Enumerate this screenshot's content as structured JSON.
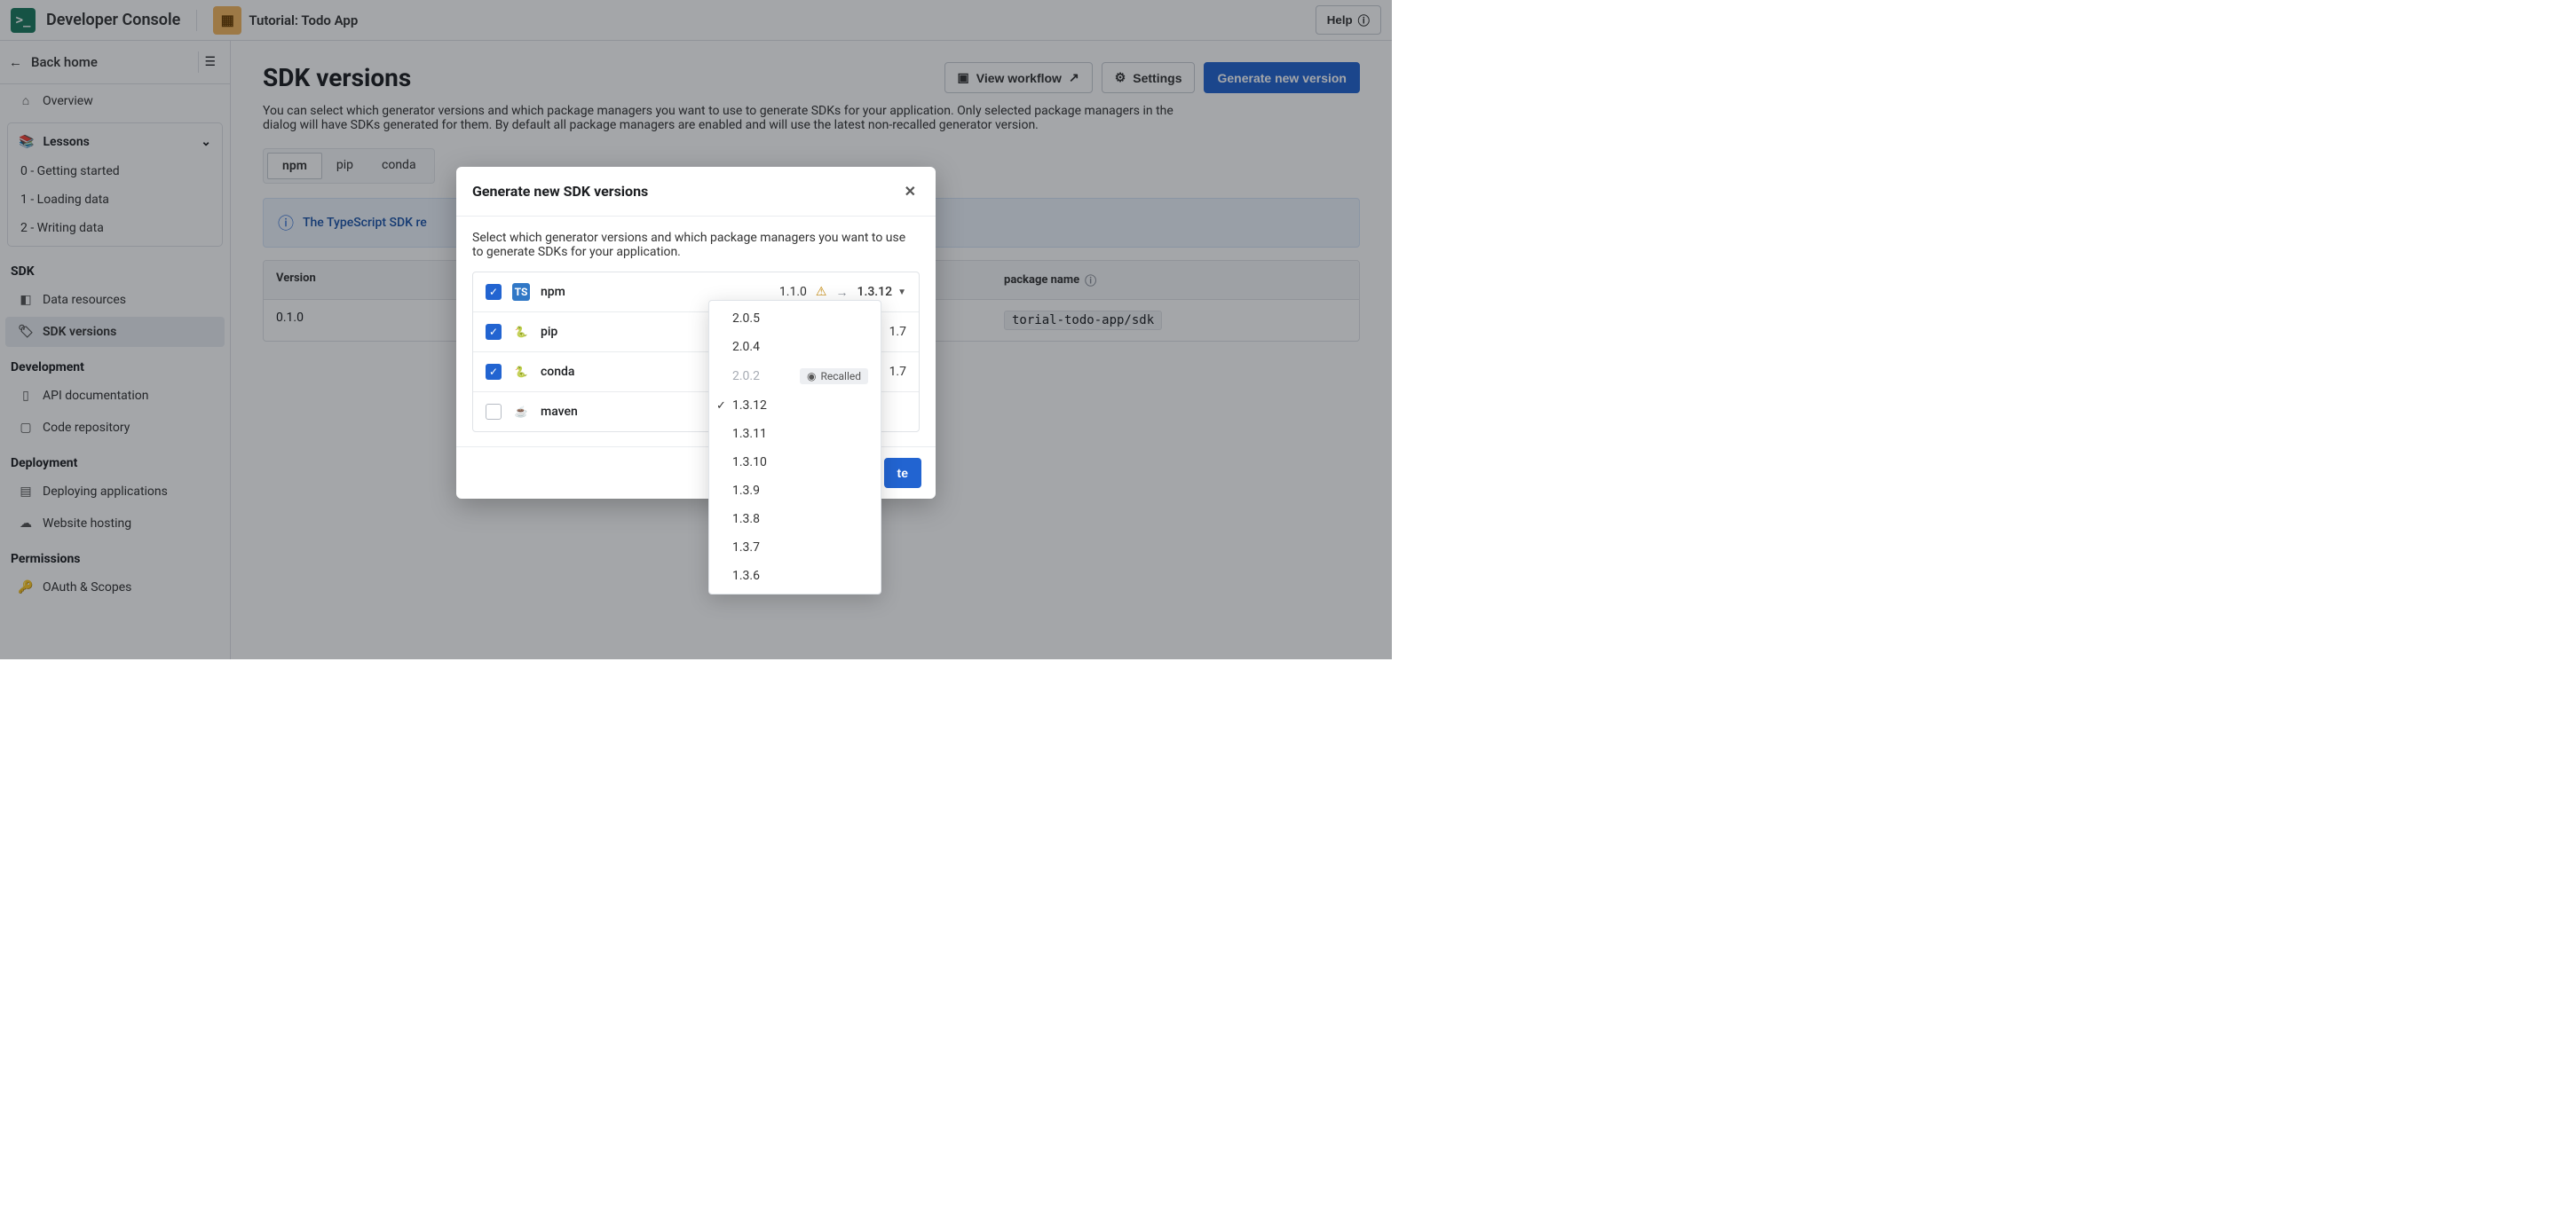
{
  "topbar": {
    "brand": "Developer Console",
    "tutorial_label": "Tutorial: Todo App",
    "help_label": "Help"
  },
  "sidebar": {
    "back_label": "Back home",
    "overview": "Overview",
    "lessons_label": "Lessons",
    "lessons": [
      "0 - Getting started",
      "1 - Loading data",
      "2 - Writing data"
    ],
    "groups": {
      "sdk_title": "SDK",
      "sdk_items": {
        "data_resources": "Data resources",
        "sdk_versions": "SDK versions"
      },
      "dev_title": "Development",
      "dev_items": {
        "api_docs": "API documentation",
        "code_repo": "Code repository"
      },
      "deploy_title": "Deployment",
      "deploy_items": {
        "deploying": "Deploying applications",
        "hosting": "Website hosting"
      },
      "perm_title": "Permissions",
      "perm_items": {
        "oauth": "OAuth & Scopes"
      }
    }
  },
  "main": {
    "title": "SDK versions",
    "view_workflow": "View workflow",
    "settings": "Settings",
    "generate_new_version": "Generate new version",
    "subtext": "You can select which generator versions and which package managers you want to use to generate SDKs for your application. Only selected package managers in the dialog will have SDKs generated for them. By default all package managers are enabled and will use the latest non-recalled generator version.",
    "tabs": [
      "npm",
      "pip",
      "conda"
    ],
    "info_banner": "The TypeScript SDK re",
    "table": {
      "col_version": "Version",
      "col_package": "package name",
      "row": {
        "version": "0.1.0",
        "pkg": "torial-todo-app/sdk"
      }
    }
  },
  "modal": {
    "title": "Generate new SDK versions",
    "desc": "Select which generator versions and which package managers you want to use to generate SDKs for your application.",
    "rows": [
      {
        "name": "npm",
        "checked": true,
        "icon": "ts",
        "from": "1.1.0",
        "warn": true,
        "to": "1.3.12"
      },
      {
        "name": "pip",
        "checked": true,
        "icon": "py",
        "from": "1.7"
      },
      {
        "name": "conda",
        "checked": true,
        "icon": "py",
        "from": "1.7"
      },
      {
        "name": "maven",
        "checked": false,
        "icon": "java"
      }
    ],
    "generate_btn": "te"
  },
  "dropdown": {
    "recalled_label": "Recalled",
    "items": [
      {
        "v": "2.0.5"
      },
      {
        "v": "2.0.4"
      },
      {
        "v": "2.0.2",
        "disabled": true,
        "recalled": true
      },
      {
        "v": "1.3.12",
        "checked": true
      },
      {
        "v": "1.3.11"
      },
      {
        "v": "1.3.10"
      },
      {
        "v": "1.3.9"
      },
      {
        "v": "1.3.8"
      },
      {
        "v": "1.3.7"
      },
      {
        "v": "1.3.6"
      }
    ]
  }
}
